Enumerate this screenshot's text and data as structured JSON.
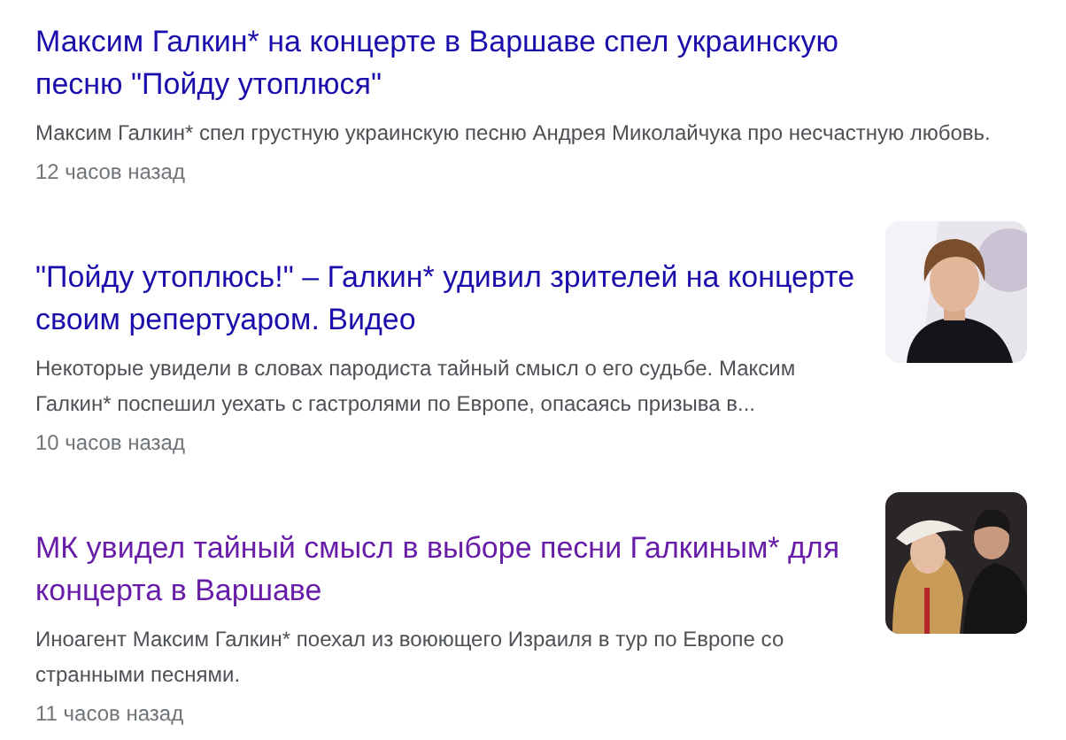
{
  "articles": [
    {
      "title": "Максим Галкин* на концерте в Варшаве спел украинскую песню \"Пойду утоплюся\"",
      "visited": false,
      "snippet": "Максим Галкин* спел грустную украинскую песню Андрея Миколайчука про несчастную любовь.",
      "time": "12 часов назад"
    },
    {
      "title": "\"Пойду утоплюсь!\" – Галкин* удивил зрителей на концерте своим репертуаром. Видео",
      "visited": false,
      "snippet": "Некоторые увидели в словах пародиста тайный смысл о его судьбе. Максим Галкин* поспешил уехать с гастролями по Европе, опасаясь призыва в...",
      "time": "10 часов назад"
    },
    {
      "title": "МК увидел тайный смысл в выборе песни Галкиным* для концерта в Варшаве",
      "visited": true,
      "snippet": "Иноагент Максим Галкин* поехал из воюющего Израиля в тур по Европе со странными песнями.",
      "time": "11 часов назад"
    }
  ]
}
